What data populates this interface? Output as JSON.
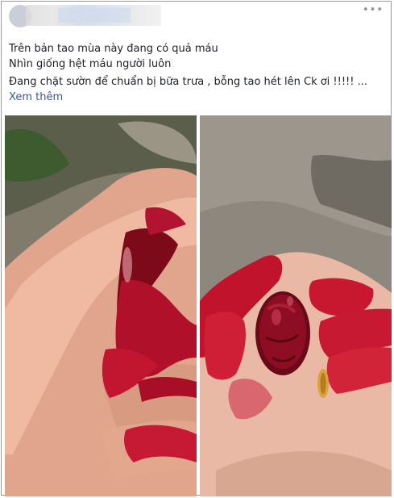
{
  "post": {
    "line1": "Trên bản tao mùa này đang có quả máu",
    "line2": "Nhìn giống hệt máu người luôn",
    "line3": "Đang chặt sườn để chuẩn bị bữa trưa , bỗng tao hét lên Ck ơi !!!!! ...",
    "see_more": "Xem thêm"
  },
  "icons": {
    "more": "more-options-icon"
  },
  "colors": {
    "text": "#1d2129",
    "link": "#385898",
    "border": "#9a9a9a",
    "blood": "#b0102a"
  }
}
